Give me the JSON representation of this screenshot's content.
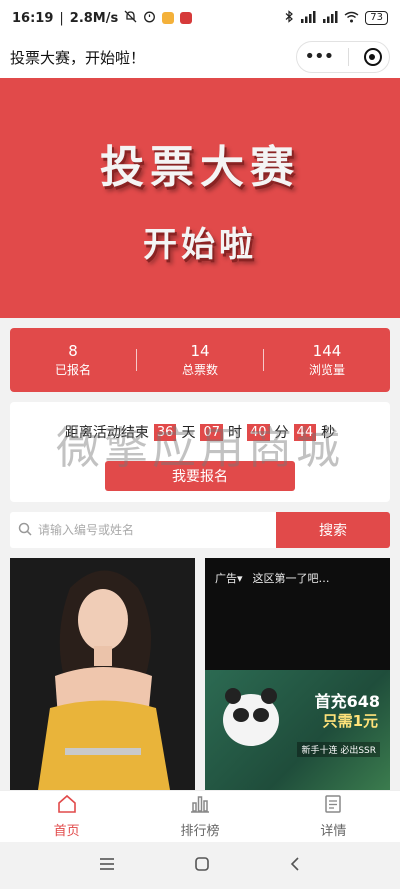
{
  "status_bar": {
    "time": "16:19",
    "speed": "2.8M/s",
    "battery": "73"
  },
  "title_bar": {
    "title": "投票大赛，开始啦！",
    "more_icon": "more-dots-icon",
    "close_icon": "target-icon"
  },
  "banner": {
    "line1": "投票大赛",
    "line2": "开始啦"
  },
  "stats": [
    {
      "value": "8",
      "label": "已报名"
    },
    {
      "value": "14",
      "label": "总票数"
    },
    {
      "value": "144",
      "label": "浏览量"
    }
  ],
  "countdown": {
    "prefix": "距离活动结束",
    "days": "36",
    "days_unit": "天",
    "hours": "07",
    "hours_unit": "时",
    "minutes": "40",
    "minutes_unit": "分",
    "seconds": "44",
    "seconds_unit": "秒",
    "signup_label": "我要报名"
  },
  "watermark": "微擎应用商城",
  "search": {
    "placeholder": "请输入编号或姓名",
    "button_label": "搜索"
  },
  "ad_card": {
    "ad_tag": "广告▾",
    "ad_text": "这区第一了吧…",
    "promo_title": "首充648",
    "promo_price": "只需1元",
    "promo_sub": "新手十连 必出SSR"
  },
  "tabs": [
    {
      "label": "首页",
      "icon": "home-icon",
      "active": true
    },
    {
      "label": "排行榜",
      "icon": "ranking-icon",
      "active": false
    },
    {
      "label": "详情",
      "icon": "details-icon",
      "active": false
    }
  ],
  "colors": {
    "accent": "#e14a4a"
  }
}
